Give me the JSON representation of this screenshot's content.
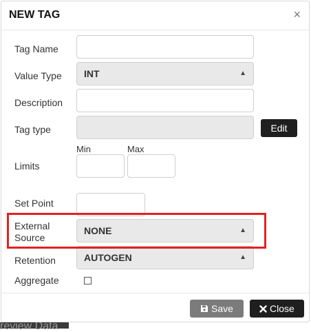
{
  "background": {
    "text": "review Data"
  },
  "modal": {
    "title": "NEW TAG",
    "close_glyph": "×"
  },
  "form": {
    "tag_name": {
      "label": "Tag Name",
      "value": ""
    },
    "value_type": {
      "label": "Value Type",
      "selected": "INT"
    },
    "description": {
      "label": "Description",
      "value": ""
    },
    "tag_type": {
      "label": "Tag type",
      "value": "",
      "edit_label": "Edit"
    },
    "limits": {
      "label": "Limits",
      "min_label": "Min",
      "max_label": "Max",
      "min_value": "",
      "max_value": ""
    },
    "set_point": {
      "label": "Set Point",
      "value": ""
    },
    "external_source": {
      "label_line1": "External",
      "label_line2": "Source",
      "selected": "NONE"
    },
    "retention": {
      "label": "Retention",
      "selected": "AUTOGEN"
    },
    "aggregate": {
      "label": "Aggregate",
      "checked": false
    }
  },
  "footer": {
    "save_label": "Save",
    "close_label": "Close"
  },
  "icons": {
    "caret": "▲",
    "save": "floppy-disk-icon",
    "close": "x-icon"
  },
  "colors": {
    "highlight": "#e32020",
    "primary_dark": "#1f1f1f",
    "save_gray": "#7b7b7b"
  }
}
